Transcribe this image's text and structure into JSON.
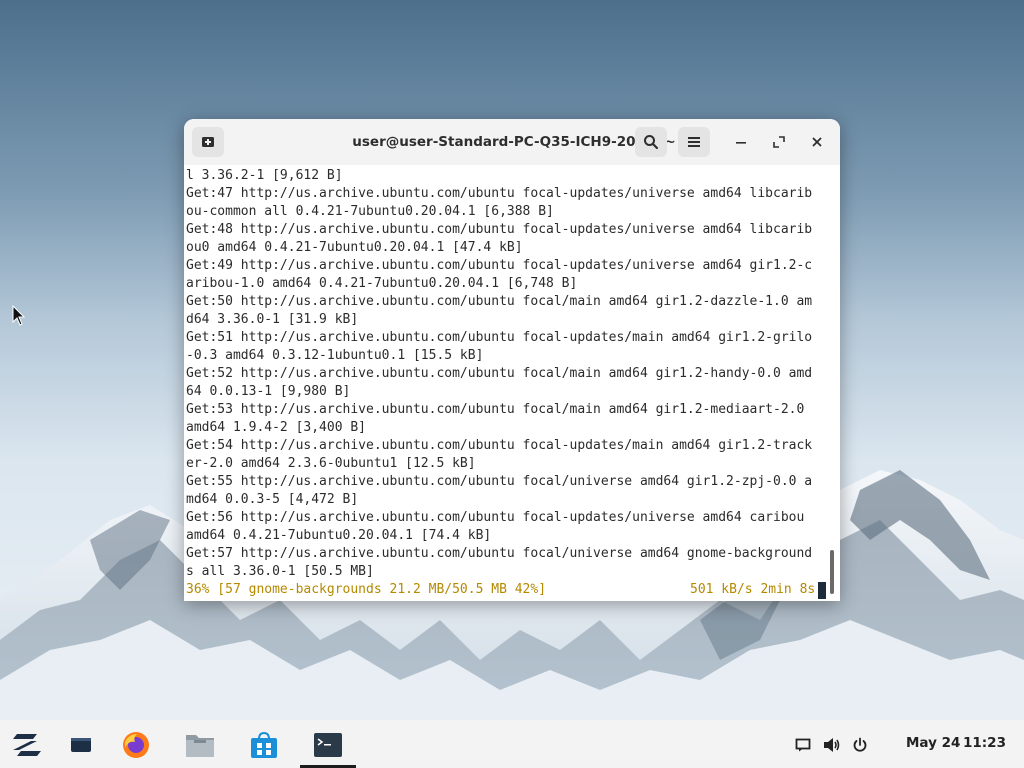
{
  "window": {
    "title": "user@user-Standard-PC-Q35-ICH9-2009: ~"
  },
  "terminal": {
    "lines": [
      "l 3.36.2-1 [9,612 B]",
      "Get:47 http://us.archive.ubuntu.com/ubuntu focal-updates/universe amd64 libcarib",
      "ou-common all 0.4.21-7ubuntu0.20.04.1 [6,388 B]",
      "Get:48 http://us.archive.ubuntu.com/ubuntu focal-updates/universe amd64 libcarib",
      "ou0 amd64 0.4.21-7ubuntu0.20.04.1 [47.4 kB]",
      "Get:49 http://us.archive.ubuntu.com/ubuntu focal-updates/universe amd64 gir1.2-c",
      "aribou-1.0 amd64 0.4.21-7ubuntu0.20.04.1 [6,748 B]",
      "Get:50 http://us.archive.ubuntu.com/ubuntu focal/main amd64 gir1.2-dazzle-1.0 am",
      "d64 3.36.0-1 [31.9 kB]",
      "Get:51 http://us.archive.ubuntu.com/ubuntu focal-updates/main amd64 gir1.2-grilo",
      "-0.3 amd64 0.3.12-1ubuntu0.1 [15.5 kB]",
      "Get:52 http://us.archive.ubuntu.com/ubuntu focal/main amd64 gir1.2-handy-0.0 amd",
      "64 0.0.13-1 [9,980 B]",
      "Get:53 http://us.archive.ubuntu.com/ubuntu focal/main amd64 gir1.2-mediaart-2.0",
      "amd64 1.9.4-2 [3,400 B]",
      "Get:54 http://us.archive.ubuntu.com/ubuntu focal-updates/main amd64 gir1.2-track",
      "er-2.0 amd64 2.3.6-0ubuntu1 [12.5 kB]",
      "Get:55 http://us.archive.ubuntu.com/ubuntu focal/universe amd64 gir1.2-zpj-0.0 a",
      "md64 0.0.3-5 [4,472 B]",
      "Get:56 http://us.archive.ubuntu.com/ubuntu focal-updates/universe amd64 caribou",
      "amd64 0.4.21-7ubuntu0.20.04.1 [74.4 kB]",
      "Get:57 http://us.archive.ubuntu.com/ubuntu focal/universe amd64 gnome-background",
      "s all 3.36.0-1 [50.5 MB]"
    ],
    "status_left": "36% [57 gnome-backgrounds 21.2 MB/50.5 MB 42%]",
    "status_right": "501 kB/s 2min 8s",
    "status_color": "#b58900"
  },
  "taskbar": {
    "date": "May 24",
    "time": "11:23",
    "icons": [
      "zorin-menu-icon",
      "workspace-icon",
      "firefox-icon",
      "files-icon",
      "software-store-icon",
      "terminal-icon"
    ]
  }
}
